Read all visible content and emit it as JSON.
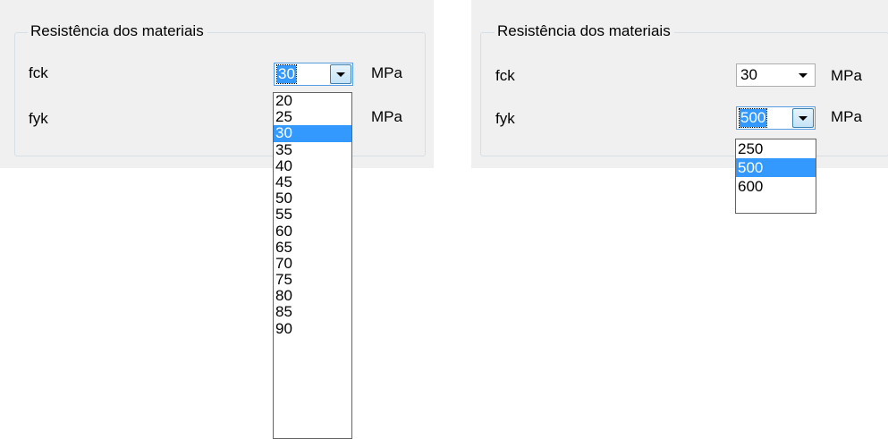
{
  "left": {
    "group_title": "Resistência dos materiais",
    "fck": {
      "label": "fck",
      "value": "30",
      "unit": "MPa"
    },
    "fyk": {
      "label": "fyk",
      "unit": "MPa"
    },
    "dropdown_options": [
      "20",
      "25",
      "30",
      "35",
      "40",
      "45",
      "50",
      "55",
      "60",
      "65",
      "70",
      "75",
      "80",
      "85",
      "90"
    ],
    "dropdown_selected": "30"
  },
  "right": {
    "group_title": "Resistência dos materiais",
    "fck": {
      "label": "fck",
      "value": "30",
      "unit": "MPa"
    },
    "fyk": {
      "label": "fyk",
      "value": "500",
      "unit": "MPa"
    },
    "dropdown_options": [
      "250",
      "500",
      "600"
    ],
    "dropdown_selected": "500"
  },
  "colors": {
    "panel_bg": "#f0f0f0",
    "highlight": "#3399ff",
    "group_border": "#d5dfe5"
  },
  "icons": {
    "combo_arrow": "chevron-down-icon"
  }
}
